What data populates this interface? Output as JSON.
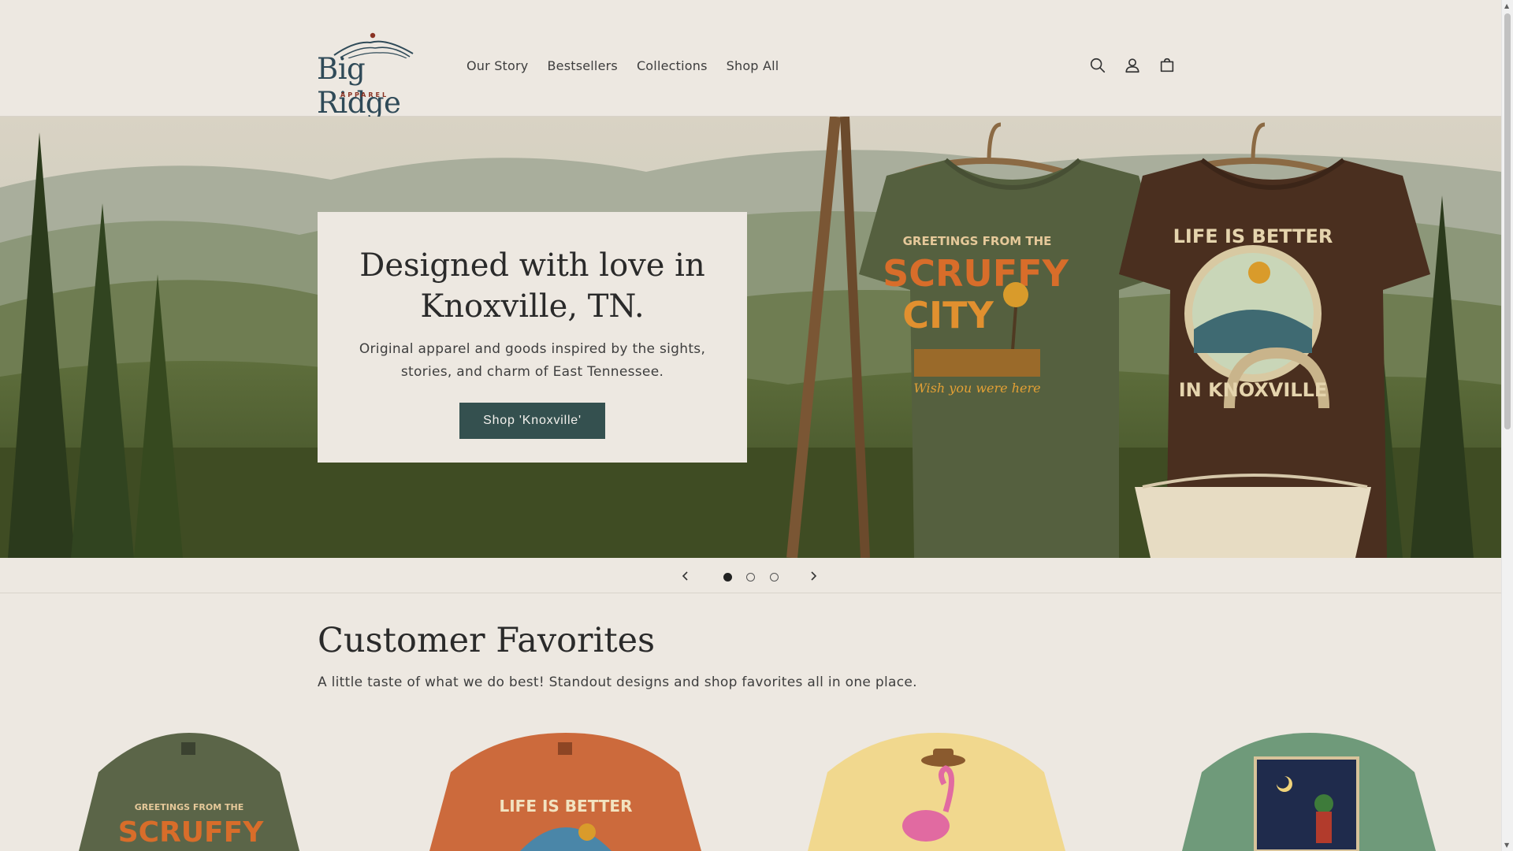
{
  "header": {
    "logo_text": "Big Ridge",
    "logo_sub": "APPAREL",
    "nav": [
      "Our Story",
      "Bestsellers",
      "Collections",
      "Shop All"
    ],
    "icons": [
      "search-icon",
      "account-icon",
      "cart-icon"
    ]
  },
  "hero": {
    "title": "Designed with love in Knoxville, TN.",
    "subtitle": "Original apparel and goods inspired by the sights, stories, and charm of East Tennessee.",
    "button": "Shop 'Knoxville'",
    "shirt1_top": "GREETINGS FROM THE",
    "shirt1_main1": "SCRUFFY",
    "shirt1_main2": "CITY",
    "shirt1_script": "Wish you were here",
    "shirt2_top": "LIFE IS BETTER",
    "shirt2_bottom": "IN KNOXVILLE"
  },
  "slider": {
    "slides": 3,
    "active": 1,
    "prev_icon": "chevron-left-icon",
    "next_icon": "chevron-right-icon"
  },
  "favorites": {
    "title": "Customer Favorites",
    "subtitle": "A little taste of what we do best! Standout designs and shop favorites all in one place.",
    "products": [
      {
        "color": "#5b6548",
        "graphic_top": "GREETINGS FROM THE",
        "graphic_main": "SCRUFFY"
      },
      {
        "color": "#cc6a3c",
        "graphic_top": "LIFE IS BETTER",
        "graphic_main": ""
      },
      {
        "color": "#f1d88e",
        "graphic_top": "",
        "graphic_main": ""
      },
      {
        "color": "#6f9a7a",
        "graphic_top": "",
        "graphic_main": ""
      }
    ]
  },
  "colors": {
    "background": "#ede8e1",
    "button": "#34504f",
    "logo_blue": "#2f4a58",
    "logo_red": "#8a3324"
  }
}
